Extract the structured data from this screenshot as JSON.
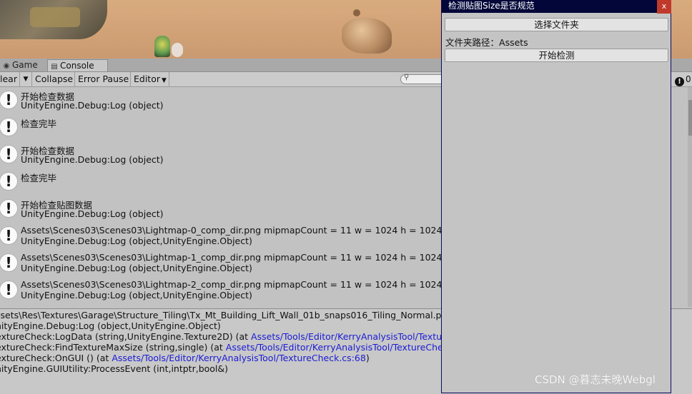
{
  "tabs": [
    {
      "label": "Game",
      "icon": "gamepad-icon"
    },
    {
      "label": "Console",
      "icon": "console-icon"
    }
  ],
  "toolbar": {
    "clear_label": "lear",
    "collapse_label": "Collapse",
    "error_pause_label": "Error Pause",
    "editor_label": "Editor",
    "search_placeholder": "",
    "counter_value": "0"
  },
  "logs": [
    {
      "line1": "开始检查数据",
      "line2": "UnityEngine.Debug:Log (object)"
    },
    {
      "line1": "检查完毕",
      "line2": ""
    },
    {
      "line1": "开始检查数据",
      "line2": "UnityEngine.Debug:Log (object)"
    },
    {
      "line1": "检查完毕",
      "line2": ""
    },
    {
      "line1": "开始检查贴图数据",
      "line2": "UnityEngine.Debug:Log (object)"
    },
    {
      "line1": "Assets\\Scenes03\\Scenes03\\Lightmap-0_comp_dir.png mipmapCount = 11 w = 1024 h = 1024",
      "line2": "UnityEngine.Debug:Log (object,UnityEngine.Object)"
    },
    {
      "line1": "Assets\\Scenes03\\Scenes03\\Lightmap-1_comp_dir.png mipmapCount = 11 w = 1024 h = 1024",
      "line2": "UnityEngine.Debug:Log (object,UnityEngine.Object)"
    },
    {
      "line1": "Assets\\Scenes03\\Scenes03\\Lightmap-2_comp_dir.png mipmapCount = 11 w = 1024 h = 1024",
      "line2": "UnityEngine.Debug:Log (object,UnityEngine.Object)"
    }
  ],
  "detail": {
    "line1": "ssets\\Res\\Textures\\Garage\\Structure_Tiling\\Tx_Mt_Building_Lift_Wall_01b_snaps016_Tiling_Normal.png mip",
    "line2": "nityEngine.Debug:Log (object,UnityEngine.Object)",
    "line3_text": "extureCheck:LogData (string,UnityEngine.Texture2D) (at ",
    "line3_link": "Assets/Tools/Editor/KerryAnalysisTool/TextureChec",
    "line4_text": "extureCheck:FindTextureMaxSize (string,single) (at ",
    "line4_link": "Assets/Tools/Editor/KerryAnalysisTool/TextureCheck.cs:",
    "line5_text": "extureCheck:OnGUI () (at ",
    "line5_link": "Assets/Tools/Editor/KerryAnalysisTool/TextureCheck.cs:68",
    "line5_tail": ")",
    "line6": "nityEngine.GUIUtility:ProcessEvent (int,intptr,bool&)"
  },
  "window": {
    "title": "检测贴图Size是否规范",
    "close_label": "x",
    "select_folder_label": "选择文件夹",
    "path_label": "文件夹路径：",
    "path_value": "Assets",
    "start_label": "开始检测"
  },
  "watermark": "CSDN @暮志未晚Webgl",
  "colors": {
    "titlebar": "#020638",
    "link": "#1b1bd6",
    "close": "#c0392b"
  }
}
